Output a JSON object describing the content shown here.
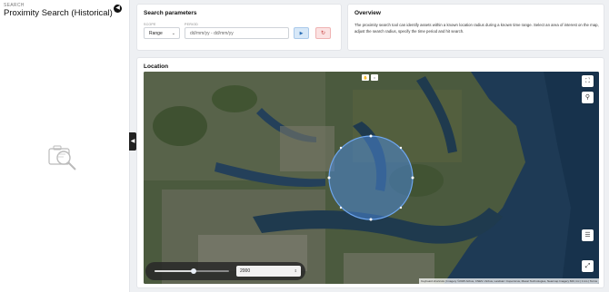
{
  "left_panel": {
    "section_label": "SEARCH",
    "title": "Proximity Search (Historical)"
  },
  "params": {
    "title": "Search parameters",
    "scope_label": "SCOPE",
    "scope_value": "Range",
    "period_label": "PERIOD",
    "period_placeholder": "dd/mm/yy - dd/mm/yy"
  },
  "overview": {
    "title": "Overview",
    "text": "The proximity search tool can identify assets within a known location radius during a known time range. Select an area of interest on the map, adjust the search radius, specify the time period and hit search."
  },
  "location": {
    "title": "Location",
    "radius_value": "2000",
    "radius_slider_level": 0.52,
    "attribution": "Keyboard shortcuts | Imagery ©2025 Airbus, CNES / Airbus, Landsat / Copernicus, Maxar Technologies, Nearmap Imagery 600, Inc | 1 km | Terms"
  },
  "icons": {
    "back": "arrow-left-icon",
    "collapse": "chevron-left-icon",
    "run": "play-icon",
    "reset": "reset-icon",
    "fullscreen": "fullscreen-icon",
    "zoom": "search-icon",
    "layers": "layers-icon",
    "recenter": "expand-icon"
  },
  "colors": {
    "run_button": "#d7e8f8",
    "reset_button": "#fbe2e2",
    "circle_fill": "#4a86d6"
  }
}
